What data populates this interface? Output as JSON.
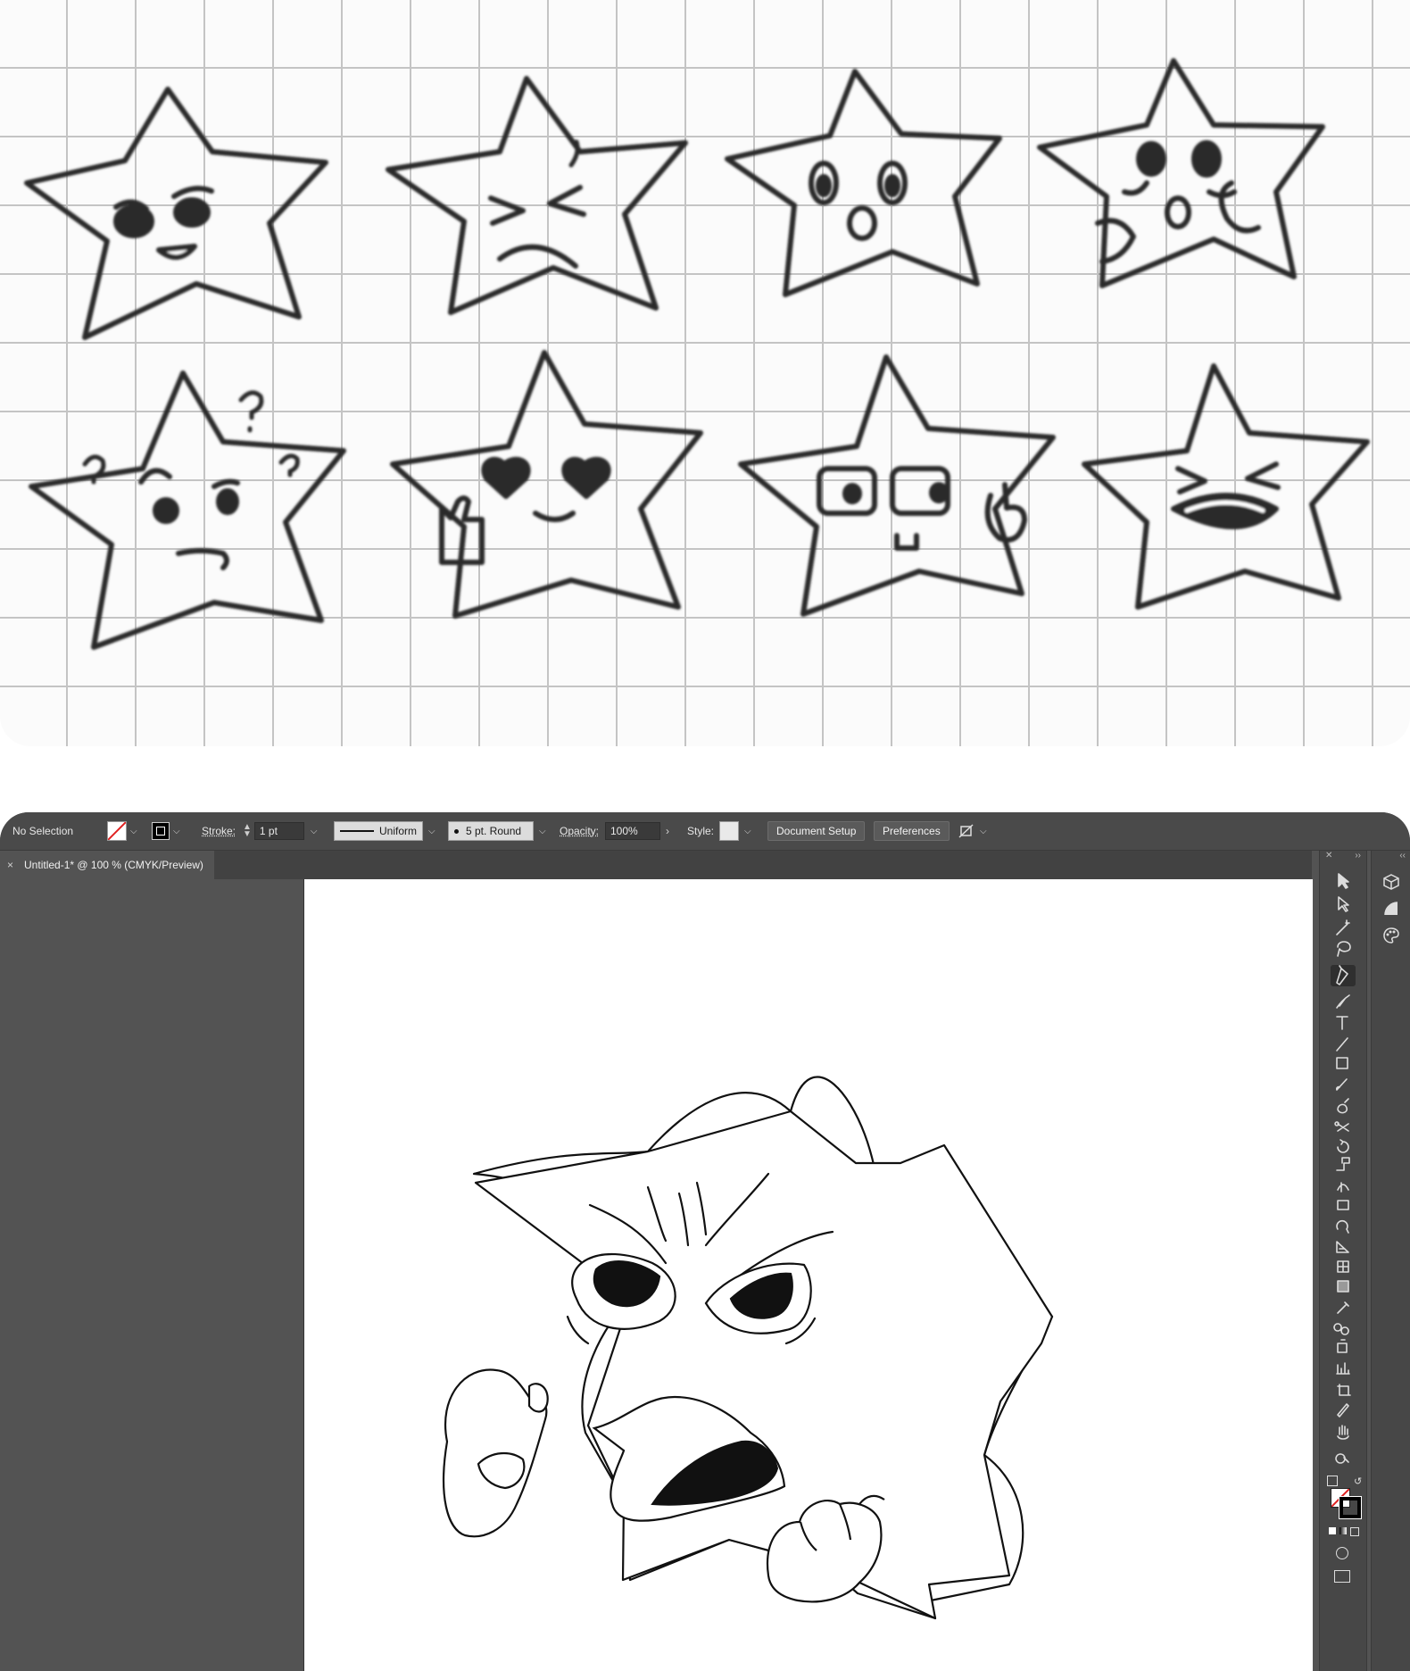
{
  "sketch": {
    "stars": [
      {
        "expression": "angry"
      },
      {
        "expression": "sweating-wince"
      },
      {
        "expression": "surprised"
      },
      {
        "expression": "shocked-hands-on-cheeks"
      },
      {
        "expression": "confused-question-marks"
      },
      {
        "expression": "heart-eyes-thumbs-up"
      },
      {
        "expression": "glasses-pointing"
      },
      {
        "expression": "laughing"
      }
    ]
  },
  "control_bar": {
    "selection_status": "No Selection",
    "stroke_label": "Stroke:",
    "stroke_weight": "1 pt",
    "profile_value": "Uniform",
    "brush_value": "5 pt. Round",
    "opacity_label": "Opacity:",
    "opacity_value": "100%",
    "style_label": "Style:",
    "document_setup_label": "Document Setup",
    "preferences_label": "Preferences"
  },
  "document": {
    "tab_title": "Untitled-1* @ 100 % (CMYK/Preview)",
    "close_glyph": "×"
  },
  "tools": [
    "selection-tool",
    "direct-selection-tool",
    "magic-wand-tool",
    "lasso-tool",
    "pen-tool",
    "curvature-tool",
    "type-tool",
    "line-segment-tool",
    "rectangle-tool",
    "paintbrush-tool",
    "shaper-tool",
    "scissors-tool",
    "rotate-tool",
    "scale-tool",
    "puppet-warp-tool",
    "free-transform-tool",
    "shape-builder-tool",
    "perspective-grid-tool",
    "mesh-tool",
    "gradient-tool",
    "eyedropper-tool",
    "blend-tool",
    "symbol-sprayer-tool",
    "column-graph-tool",
    "artboard-tool",
    "slice-tool",
    "hand-tool",
    "zoom-tool"
  ],
  "active_tool": "pen-tool",
  "dock_panels": [
    "3d-materials-icon",
    "transparency-icon",
    "color-palette-icon"
  ],
  "colors": {
    "ui_dark": "#535353",
    "control_bar": "#4a4a4a",
    "artboard": "#ffffff",
    "ink": "#111111"
  }
}
